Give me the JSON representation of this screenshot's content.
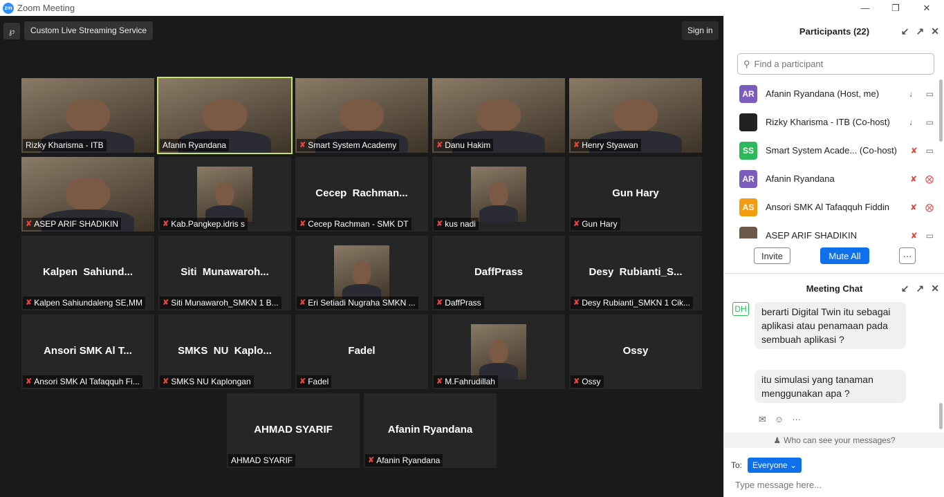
{
  "window": {
    "title": "Zoom Meeting",
    "logo": "zm"
  },
  "toolbar": {
    "stream_label": "Custom Live Streaming Service",
    "signin_label": "Sign in"
  },
  "tiles": [
    {
      "label": "Rizky Kharisma - ITB",
      "big": "",
      "muted": false,
      "video": "full"
    },
    {
      "label": "Afanin Ryandana",
      "big": "",
      "muted": false,
      "video": "full",
      "active": true
    },
    {
      "label": "Smart System Academy",
      "big": "",
      "muted": true,
      "video": "full"
    },
    {
      "label": "Danu Hakim",
      "big": "",
      "muted": true,
      "video": "full"
    },
    {
      "label": "Henry Styawan",
      "big": "",
      "muted": true,
      "video": "full"
    },
    {
      "label": "ASEP ARIF SHADIKIN",
      "big": "",
      "muted": true,
      "video": "full"
    },
    {
      "label": "Kab.Pangkep.idris s",
      "big": "",
      "muted": true,
      "video": "small"
    },
    {
      "label": "Cecep Rachman - SMK DT",
      "big": "Cecep  Rachman...",
      "muted": true,
      "video": "none"
    },
    {
      "label": "kus nadi",
      "big": "",
      "muted": true,
      "video": "small"
    },
    {
      "label": "Gun Hary",
      "big": "Gun Hary",
      "muted": true,
      "video": "none"
    },
    {
      "label": "Kalpen Sahiundaleng SE,MM",
      "big": "Kalpen  Sahiund...",
      "muted": true,
      "video": "none"
    },
    {
      "label": "Siti Munawaroh_SMKN 1 B...",
      "big": "Siti  Munawaroh...",
      "muted": true,
      "video": "none"
    },
    {
      "label": "Eri Setiadi Nugraha SMKN ...",
      "big": "",
      "muted": true,
      "video": "small"
    },
    {
      "label": "DaffPrass",
      "big": "DaffPrass",
      "muted": true,
      "video": "none"
    },
    {
      "label": "Desy Rubianti_SMKN 1 Cik...",
      "big": "Desy  Rubianti_S...",
      "muted": true,
      "video": "none"
    },
    {
      "label": "Ansori SMK Al Tafaqquh Fi...",
      "big": "Ansori SMK Al T...",
      "muted": true,
      "video": "none"
    },
    {
      "label": "SMKS NU Kaplongan",
      "big": "SMKS  NU  Kaplo...",
      "muted": true,
      "video": "none"
    },
    {
      "label": "Fadel",
      "big": "Fadel",
      "muted": true,
      "video": "none"
    },
    {
      "label": "M.Fahrudillah",
      "big": "",
      "muted": true,
      "video": "small"
    },
    {
      "label": "Ossy",
      "big": "Ossy",
      "muted": true,
      "video": "none"
    },
    {
      "label": "AHMAD SYARIF",
      "big": "AHMAD SYARIF",
      "muted": false,
      "video": "none"
    },
    {
      "label": "Afanin Ryandana",
      "big": "Afanin Ryandana",
      "muted": true,
      "video": "none"
    }
  ],
  "participants_panel": {
    "title": "Participants (22)",
    "search_placeholder": "Find a participant",
    "participants": [
      {
        "initials": "AR",
        "name": "Afanin Ryandana (Host, me)",
        "color": "#7c5cbf",
        "mic": "on",
        "video": "on"
      },
      {
        "initials": "",
        "name": "Rizky Kharisma - ITB (Co-host)",
        "color": "#222222",
        "mic": "on",
        "video": "on"
      },
      {
        "initials": "SS",
        "name": "Smart System Acade...  (Co-host)",
        "color": "#2eb85c",
        "mic": "off",
        "video": "on"
      },
      {
        "initials": "AR",
        "name": "Afanin Ryandana",
        "color": "#7c5cbf",
        "mic": "off",
        "video": "off"
      },
      {
        "initials": "AS",
        "name": "Ansori SMK Al Tafaqquh Fiddin",
        "color": "#f39c12",
        "mic": "off",
        "video": "off"
      },
      {
        "initials": "",
        "name": "ASEP ARIF SHADIKIN",
        "color": "#6b5a4a",
        "mic": "off",
        "video": "on"
      }
    ],
    "invite_label": "Invite",
    "mute_all_label": "Mute All",
    "more_label": "···"
  },
  "chat": {
    "title": "Meeting Chat",
    "sender_initials": "DH",
    "messages": [
      "berarti Digital Twin itu sebagai aplikasi atau penamaan pada sembuah aplikasi ?",
      "itu simulasi yang tanaman menggunakan apa ?"
    ],
    "who_can_see": "Who can see your messages?",
    "to_label": "To:",
    "to_value": "Everyone",
    "input_placeholder": "Type message here..."
  },
  "colors": {
    "accent": "#0e71eb",
    "active_speaker": "#c7e36a",
    "mic_off": "#e0463e"
  }
}
